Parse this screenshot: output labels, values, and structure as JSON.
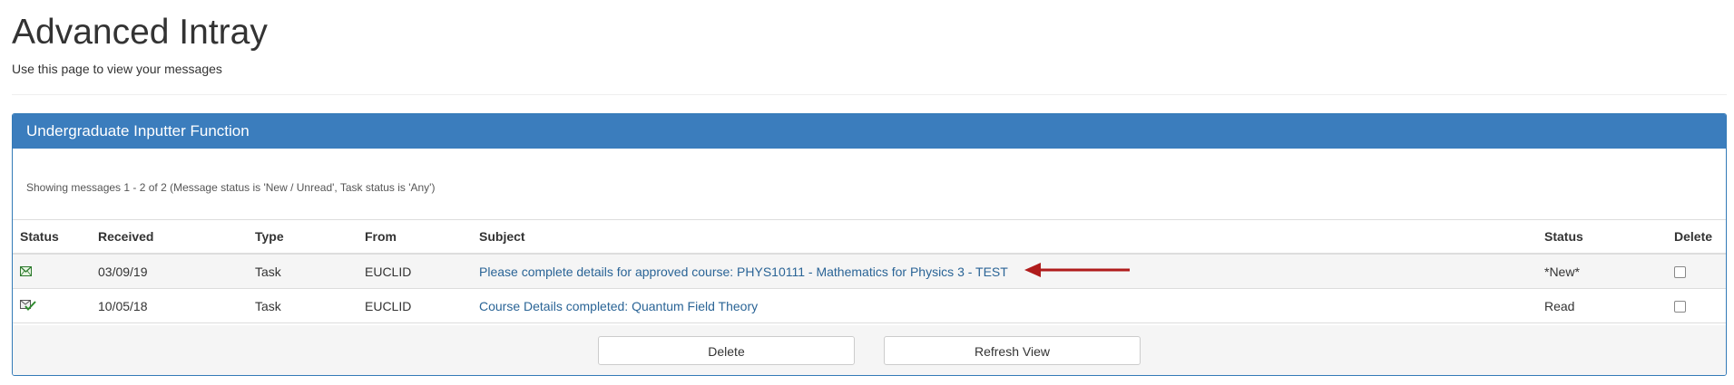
{
  "header": {
    "title": "Advanced Intray",
    "subtitle": "Use this page to view your messages"
  },
  "panel": {
    "title": "Undergraduate Inputter Function",
    "summary": "Showing messages 1 - 2 of 2 (Message status is 'New / Unread', Task status is 'Any')"
  },
  "table": {
    "headers": {
      "status_icon": "Status",
      "received": "Received",
      "type": "Type",
      "from": "From",
      "subject": "Subject",
      "status": "Status",
      "delete": "Delete"
    },
    "rows": [
      {
        "icon": "envelope-icon",
        "received": "03/09/19",
        "type": "Task",
        "from": "EUCLID",
        "subject": "Please complete details for approved course: PHYS10111 - Mathematics for Physics 3 - TEST",
        "status": "*New*"
      },
      {
        "icon": "read-check-icon",
        "received": "10/05/18",
        "type": "Task",
        "from": "EUCLID",
        "subject": "Course Details completed: Quantum Field Theory",
        "status": "Read"
      }
    ]
  },
  "actions": {
    "delete_label": "Delete",
    "refresh_label": "Refresh View"
  },
  "colors": {
    "panel_heading": "#3b7dbd",
    "link": "#2a6496",
    "arrow": "#b01c1c"
  }
}
